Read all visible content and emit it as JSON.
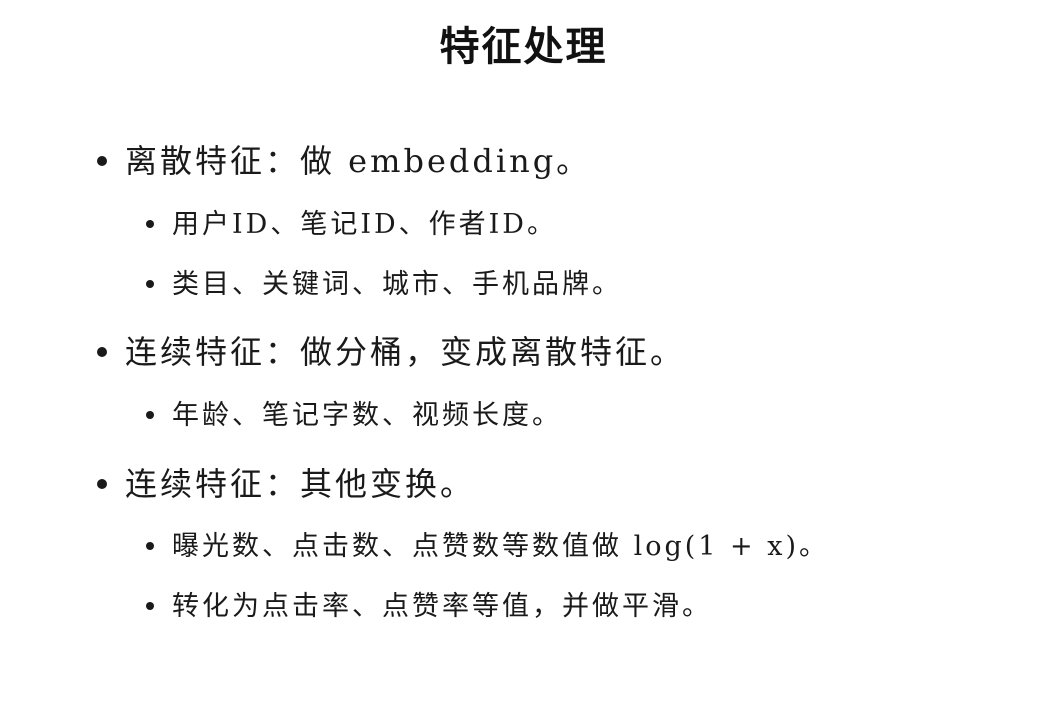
{
  "title": "特征处理",
  "items": [
    {
      "level": 1,
      "text": "离散特征：做 embedding。"
    },
    {
      "level": 2,
      "text": "用户ID、笔记ID、作者ID。"
    },
    {
      "level": 2,
      "text": "类目、关键词、城市、手机品牌。"
    },
    {
      "level": 1,
      "text": "连续特征：做分桶，变成离散特征。"
    },
    {
      "level": 2,
      "text": "年龄、笔记字数、视频长度。"
    },
    {
      "level": 1,
      "text": "连续特征：其他变换。"
    },
    {
      "level": 2,
      "text": "曝光数、点击数、点赞数等数值做 log(1 + x)。"
    },
    {
      "level": 2,
      "text": "转化为点击率、点赞率等值，并做平滑。"
    }
  ]
}
